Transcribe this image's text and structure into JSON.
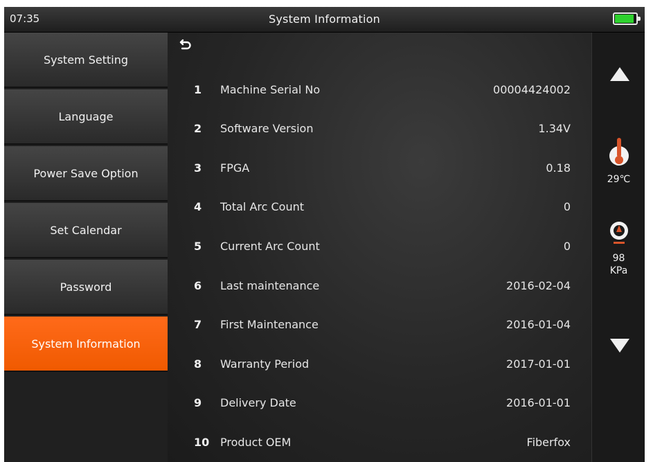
{
  "status_bar": {
    "time": "07:35",
    "title": "System Information",
    "battery_level": 0.9,
    "battery_color": "#2ed12e"
  },
  "sidebar": {
    "items": [
      {
        "label": "System Setting",
        "active": false
      },
      {
        "label": "Language",
        "active": false
      },
      {
        "label": "Power Save Option",
        "active": false
      },
      {
        "label": "Set Calendar",
        "active": false
      },
      {
        "label": "Password",
        "active": false
      },
      {
        "label": "System Information",
        "active": true
      }
    ],
    "accent_color": "#f05a00"
  },
  "main": {
    "back_icon": "return-arrow-icon",
    "rows": [
      {
        "num": "1",
        "label": "Machine Serial No",
        "value": "00004424002"
      },
      {
        "num": "2",
        "label": "Software Version",
        "value": "1.34V"
      },
      {
        "num": "3",
        "label": "FPGA",
        "value": "0.18"
      },
      {
        "num": "4",
        "label": "Total Arc Count",
        "value": "0"
      },
      {
        "num": "5",
        "label": "Current Arc Count",
        "value": "0"
      },
      {
        "num": "6",
        "label": "Last maintenance",
        "value": "2016-02-04"
      },
      {
        "num": "7",
        "label": "First Maintenance",
        "value": "2016-01-04"
      },
      {
        "num": "8",
        "label": "Warranty Period",
        "value": "2017-01-01"
      },
      {
        "num": "9",
        "label": "Delivery Date",
        "value": "2016-01-01"
      },
      {
        "num": "10",
        "label": "Product OEM",
        "value": "Fiberfox"
      }
    ]
  },
  "status": {
    "temperature": "29℃",
    "pressure_value": "98",
    "pressure_unit": "KPa",
    "temp_icon": "thermometer-icon",
    "pressure_icon": "gauge-icon"
  }
}
